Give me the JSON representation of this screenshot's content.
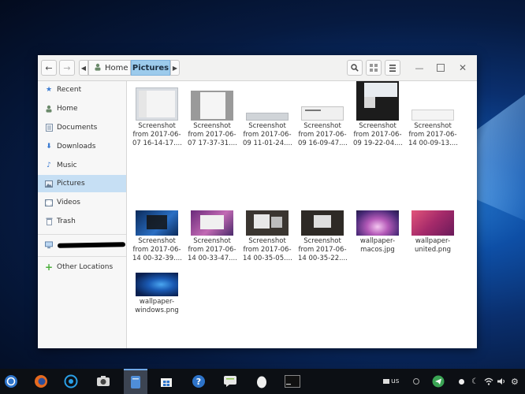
{
  "window": {
    "breadcrumbs": [
      {
        "label": "Home"
      },
      {
        "label": "Pictures"
      }
    ]
  },
  "sidebar": {
    "items": [
      {
        "label": "Recent",
        "icon": "clock-star-icon"
      },
      {
        "label": "Home",
        "icon": "home-icon"
      },
      {
        "label": "Documents",
        "icon": "document-icon"
      },
      {
        "label": "Downloads",
        "icon": "download-icon"
      },
      {
        "label": "Music",
        "icon": "music-icon"
      },
      {
        "label": "Pictures",
        "icon": "pictures-icon"
      },
      {
        "label": "Videos",
        "icon": "video-icon"
      },
      {
        "label": "Trash",
        "icon": "trash-icon"
      }
    ],
    "other_locations": "Other Locations"
  },
  "files": [
    {
      "line1": "Screenshot",
      "line2": "from 2017-06-",
      "line3": "07 16-14-17...."
    },
    {
      "line1": "Screenshot",
      "line2": "from 2017-06-",
      "line3": "07 17-37-31...."
    },
    {
      "line1": "Screenshot",
      "line2": "from 2017-06-",
      "line3": "09 11-01-24...."
    },
    {
      "line1": "Screenshot",
      "line2": "from 2017-06-",
      "line3": "09 16-09-47...."
    },
    {
      "line1": "Screenshot",
      "line2": "from 2017-06-",
      "line3": "09 19-22-04...."
    },
    {
      "line1": "Screenshot",
      "line2": "from 2017-06-",
      "line3": "14 00-09-13...."
    },
    {
      "line1": "Screenshot",
      "line2": "from 2017-06-",
      "line3": "14 00-32-39...."
    },
    {
      "line1": "Screenshot",
      "line2": "from 2017-06-",
      "line3": "14 00-33-47...."
    },
    {
      "line1": "Screenshot",
      "line2": "from 2017-06-",
      "line3": "14 00-35-05...."
    },
    {
      "line1": "Screenshot",
      "line2": "from 2017-06-",
      "line3": "14 00-35-22...."
    },
    {
      "line1": "wallpaper-",
      "line2": "macos.jpg",
      "line3": ""
    },
    {
      "line1": "wallpaper-",
      "line2": "united.png",
      "line3": ""
    },
    {
      "line1": "wallpaper-",
      "line2": "windows.png",
      "line3": ""
    }
  ],
  "taskbar": {
    "keyboard_layout": "us"
  },
  "colors": {
    "accent": "#9ccbec",
    "sidebar_selected": "#c6dff4"
  }
}
